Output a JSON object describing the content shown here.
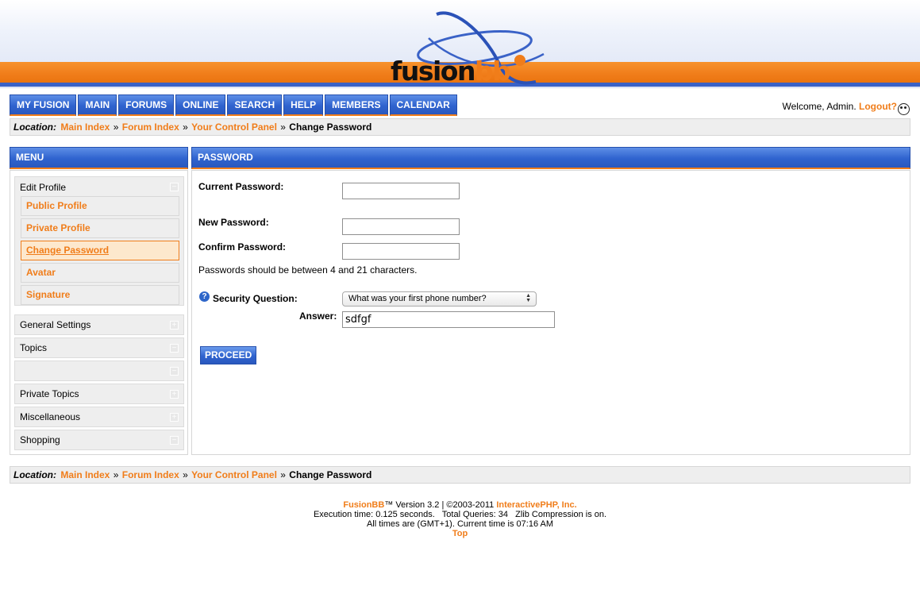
{
  "header": {
    "logo_text_main": "fusion",
    "logo_text_accent": "bb"
  },
  "nav": {
    "items": [
      "MY FUSION",
      "MAIN",
      "FORUMS",
      "ONLINE",
      "SEARCH",
      "HELP",
      "MEMBERS",
      "CALENDAR"
    ]
  },
  "welcome": {
    "text": "Welcome, Admin.",
    "logout_label": "Logout?"
  },
  "location": {
    "label": "Location:",
    "crumbs": [
      "Main Index",
      "Forum Index",
      "Your Control Panel"
    ],
    "separator": "»",
    "current": "Change Password"
  },
  "menu": {
    "title": "MENU",
    "edit_profile": {
      "label": "Edit Profile",
      "items": [
        "Public Profile",
        "Private Profile",
        "Change Password",
        "Avatar",
        "Signature"
      ],
      "active": "Change Password"
    },
    "items": [
      "General Settings",
      "Topics",
      "",
      "Private Topics",
      "Miscellaneous",
      "Shopping"
    ]
  },
  "password": {
    "title": "PASSWORD",
    "current_label": "Current Password:",
    "current_value": "",
    "new_label": "New Password:",
    "new_value": "",
    "confirm_label": "Confirm Password:",
    "confirm_value": "",
    "note": "Passwords should be between 4 and 21 characters.",
    "security_label": "Security Question:",
    "security_selected": "What was your first phone number?",
    "answer_label": "Answer:",
    "answer_value": "sdfgf",
    "proceed_label": "PROCEED"
  },
  "footer": {
    "product": "FusionBB",
    "version_text": "™ Version 3.2 | ©2003-2011",
    "company": "InteractivePHP, Inc.",
    "exec_line": "Execution time: 0.125 seconds.   Total Queries: 34   Zlib Compression is on.",
    "time_line": "All times are (GMT+1). Current time is 07:16 AM",
    "top_label": "Top"
  },
  "colors": {
    "accent_orange": "#f07d1a",
    "nav_blue": "#2f63cf",
    "active_bg": "#fde8cd"
  }
}
